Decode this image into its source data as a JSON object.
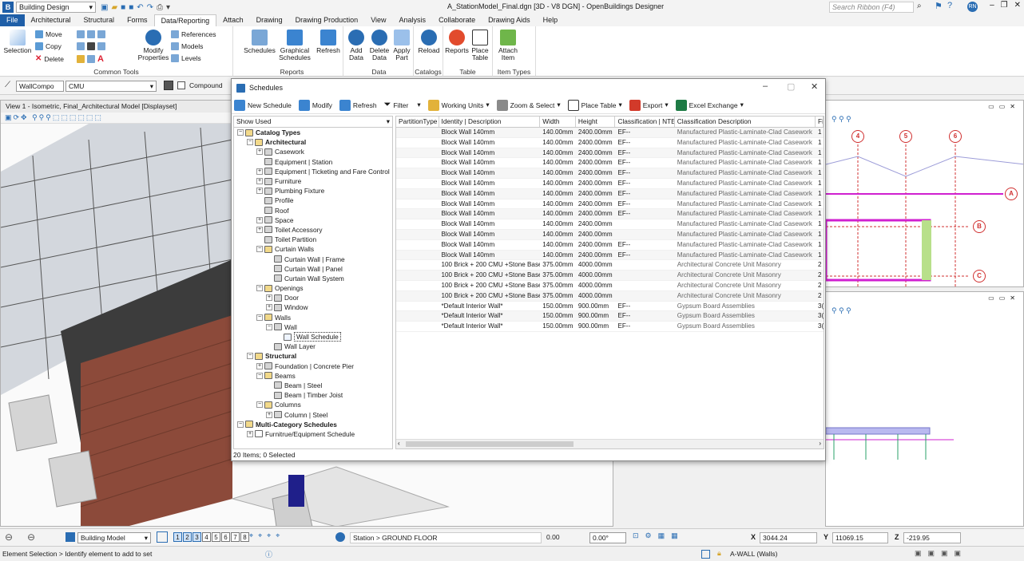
{
  "titlebar": {
    "workspace": "Building Design",
    "title": "A_StationModel_Final.dgn [3D - V8 DGN] - OpenBuildings Designer",
    "search_placeholder": "Search Ribbon (F4)",
    "user_initials": "RN"
  },
  "tabs": [
    "File",
    "Architectural",
    "Structural",
    "Forms",
    "Data/Reporting",
    "Attach",
    "Drawing",
    "Drawing Production",
    "View",
    "Analysis",
    "Collaborate",
    "Drawing Aids",
    "Help"
  ],
  "ribbon": {
    "selection": "Selection",
    "move": "Move",
    "copy": "Copy",
    "delete": "Delete",
    "modify_properties": "Modify Properties",
    "references": "References",
    "models": "Models",
    "levels": "Levels",
    "common_tools": "Common Tools",
    "schedules": "Schedules",
    "graphical_schedules": "Graphical Schedules",
    "refresh": "Refresh",
    "reports_group": "Reports",
    "add_data": "Add Data",
    "delete_data": "Delete Data",
    "apply_part": "Apply Part",
    "data_group": "Data",
    "reload": "Reload",
    "catalogs_group": "Catalogs",
    "reports": "Reports",
    "place_table": "Place Table",
    "table_group": "Table",
    "attach_item": "Attach Item",
    "item_types_group": "Item Types"
  },
  "attrbar": {
    "style": "WallCompo",
    "material": "CMU",
    "compound": "Compound"
  },
  "view1": {
    "title": "View 1 - Isometric, Final_Architectural Model [Displayset]"
  },
  "grid_markers": [
    "4",
    "5",
    "6",
    "A",
    "B",
    "C"
  ],
  "schedules": {
    "title": "Schedules",
    "toolbar": {
      "new_schedule": "New Schedule",
      "modify": "Modify",
      "refresh": "Refresh",
      "filter": "Filter",
      "working_units": "Working Units",
      "zoom_select": "Zoom & Select",
      "place_table": "Place Table",
      "export": "Export",
      "excel_exchange": "Excel Exchange"
    },
    "tree_filter": "Show Used",
    "tree": [
      {
        "label": "Catalog Types",
        "indent": 0,
        "twist": "-",
        "icon": "folder",
        "bold": true
      },
      {
        "label": "Architectural",
        "indent": 1,
        "twist": "-",
        "icon": "folder",
        "bold": true
      },
      {
        "label": "Casework",
        "indent": 2,
        "twist": "+",
        "icon": "cube"
      },
      {
        "label": "Equipment | Station",
        "indent": 2,
        "twist": "",
        "icon": "cube"
      },
      {
        "label": "Equipment | Ticketing and Fare Control",
        "indent": 2,
        "twist": "+",
        "icon": "cube"
      },
      {
        "label": "Furniture",
        "indent": 2,
        "twist": "+",
        "icon": "cube"
      },
      {
        "label": "Plumbing Fixture",
        "indent": 2,
        "twist": "+",
        "icon": "cube"
      },
      {
        "label": "Profile",
        "indent": 2,
        "twist": "",
        "icon": "cube"
      },
      {
        "label": "Roof",
        "indent": 2,
        "twist": "",
        "icon": "cube"
      },
      {
        "label": "Space",
        "indent": 2,
        "twist": "+",
        "icon": "cube"
      },
      {
        "label": "Toilet Accessory",
        "indent": 2,
        "twist": "+",
        "icon": "cube"
      },
      {
        "label": "Toilet Partition",
        "indent": 2,
        "twist": "",
        "icon": "cube"
      },
      {
        "label": "Curtain Walls",
        "indent": 2,
        "twist": "-",
        "icon": "folder"
      },
      {
        "label": "Curtain Wall | Frame",
        "indent": 3,
        "twist": "",
        "icon": "cube"
      },
      {
        "label": "Curtain Wall | Panel",
        "indent": 3,
        "twist": "",
        "icon": "cube"
      },
      {
        "label": "Curtain Wall System",
        "indent": 3,
        "twist": "",
        "icon": "cube"
      },
      {
        "label": "Openings",
        "indent": 2,
        "twist": "-",
        "icon": "folder"
      },
      {
        "label": "Door",
        "indent": 3,
        "twist": "+",
        "icon": "cube"
      },
      {
        "label": "Window",
        "indent": 3,
        "twist": "+",
        "icon": "cube"
      },
      {
        "label": "Walls",
        "indent": 2,
        "twist": "-",
        "icon": "folder"
      },
      {
        "label": "Wall",
        "indent": 3,
        "twist": "-",
        "icon": "cube"
      },
      {
        "label": "Wall Schedule",
        "indent": 4,
        "twist": "",
        "icon": "table",
        "selected": true
      },
      {
        "label": "Wall Layer",
        "indent": 3,
        "twist": "",
        "icon": "cube"
      },
      {
        "label": "Structural",
        "indent": 1,
        "twist": "-",
        "icon": "folder",
        "bold": true
      },
      {
        "label": "Foundation | Concrete Pier",
        "indent": 2,
        "twist": "+",
        "icon": "cube"
      },
      {
        "label": "Beams",
        "indent": 2,
        "twist": "-",
        "icon": "folder"
      },
      {
        "label": "Beam | Steel",
        "indent": 3,
        "twist": "",
        "icon": "cube"
      },
      {
        "label": "Beam | Timber Joist",
        "indent": 3,
        "twist": "",
        "icon": "cube"
      },
      {
        "label": "Columns",
        "indent": 2,
        "twist": "-",
        "icon": "folder"
      },
      {
        "label": "Column | Steel",
        "indent": 3,
        "twist": "+",
        "icon": "cube"
      },
      {
        "label": "Multi-Category Schedules",
        "indent": 0,
        "twist": "-",
        "icon": "folder",
        "bold": true
      },
      {
        "label": "Furnitrue/Equipment Schedule",
        "indent": 1,
        "twist": "+",
        "icon": "sheet"
      }
    ],
    "columns": [
      "PartitionType",
      "Identity | Description",
      "Width",
      "Height",
      "Classification | NTE",
      "Classification Description",
      "Fi"
    ],
    "rows": [
      [
        "",
        "Block Wall 140mm",
        "140.00mm",
        "2400.00mm",
        "EF--",
        "Manufactured Plastic-Laminate-Clad Casework",
        "1"
      ],
      [
        "",
        "Block Wall 140mm",
        "140.00mm",
        "2400.00mm",
        "EF--",
        "Manufactured Plastic-Laminate-Clad Casework",
        "1"
      ],
      [
        "",
        "Block Wall 140mm",
        "140.00mm",
        "2400.00mm",
        "EF--",
        "Manufactured Plastic-Laminate-Clad Casework",
        "1"
      ],
      [
        "",
        "Block Wall 140mm",
        "140.00mm",
        "2400.00mm",
        "EF--",
        "Manufactured Plastic-Laminate-Clad Casework",
        "1"
      ],
      [
        "",
        "Block Wall 140mm",
        "140.00mm",
        "2400.00mm",
        "EF--",
        "Manufactured Plastic-Laminate-Clad Casework",
        "1"
      ],
      [
        "",
        "Block Wall 140mm",
        "140.00mm",
        "2400.00mm",
        "EF--",
        "Manufactured Plastic-Laminate-Clad Casework",
        "1"
      ],
      [
        "",
        "Block Wall 140mm",
        "140.00mm",
        "2400.00mm",
        "EF--",
        "Manufactured Plastic-Laminate-Clad Casework",
        "1"
      ],
      [
        "",
        "Block Wall 140mm",
        "140.00mm",
        "2400.00mm",
        "EF--",
        "Manufactured Plastic-Laminate-Clad Casework",
        "1"
      ],
      [
        "",
        "Block Wall 140mm",
        "140.00mm",
        "2400.00mm",
        "EF--",
        "Manufactured Plastic-Laminate-Clad Casework",
        "1"
      ],
      [
        "",
        "Block Wall 140mm",
        "140.00mm",
        "2400.00mm",
        "",
        "Manufactured Plastic-Laminate-Clad Casework",
        "1"
      ],
      [
        "",
        "Block Wall 140mm",
        "140.00mm",
        "2400.00mm",
        "",
        "Manufactured Plastic-Laminate-Clad Casework",
        "1"
      ],
      [
        "",
        "Block Wall 140mm",
        "140.00mm",
        "2400.00mm",
        "EF--",
        "Manufactured Plastic-Laminate-Clad Casework",
        "1"
      ],
      [
        "",
        "Block Wall 140mm",
        "140.00mm",
        "2400.00mm",
        "EF--",
        "Manufactured Plastic-Laminate-Clad Casework",
        "1"
      ],
      [
        "",
        "100 Brick + 200 CMU +Stone Base",
        "375.00mm",
        "4000.00mm",
        "",
        "Architectural Concrete Unit Masonry",
        "2"
      ],
      [
        "",
        "100 Brick + 200 CMU +Stone Base",
        "375.00mm",
        "4000.00mm",
        "",
        "Architectural Concrete Unit Masonry",
        "2"
      ],
      [
        "",
        "100 Brick + 200 CMU +Stone Base",
        "375.00mm",
        "4000.00mm",
        "",
        "Architectural Concrete Unit Masonry",
        "2"
      ],
      [
        "",
        "100 Brick + 200 CMU +Stone Base",
        "375.00mm",
        "4000.00mm",
        "",
        "Architectural Concrete Unit Masonry",
        "2"
      ],
      [
        "",
        "*Default Interior Wall*",
        "150.00mm",
        "900.00mm",
        "EF--",
        "Gypsum Board Assemblies",
        "3("
      ],
      [
        "",
        "*Default Interior Wall*",
        "150.00mm",
        "900.00mm",
        "EF--",
        "Gypsum Board Assemblies",
        "3("
      ],
      [
        "",
        "*Default Interior Wall*",
        "150.00mm",
        "900.00mm",
        "EF--",
        "Gypsum Board Assemblies",
        "3("
      ]
    ],
    "status": "20 Items; 0 Selected"
  },
  "bottom": {
    "model": "Building Model",
    "views": [
      "1",
      "2",
      "3",
      "4",
      "5",
      "6",
      "7",
      "8"
    ],
    "active_views": [
      "1",
      "2",
      "3"
    ],
    "floor": "Station > GROUND FLOOR",
    "elev": "0.00",
    "angle": "0.00°",
    "x_label": "X",
    "x": "3044.24",
    "y_label": "Y",
    "y": "11069.15",
    "z_label": "Z",
    "z": "-219.95"
  },
  "status": {
    "prompt": "Element Selection > Identify element to add to set",
    "level": "A-WALL (Walls)"
  },
  "colors": {
    "accent": "#1f5fa8",
    "file_tab": "#1f5fa8",
    "grid_bubble": "#d03030",
    "magenta": "#d020d0"
  }
}
